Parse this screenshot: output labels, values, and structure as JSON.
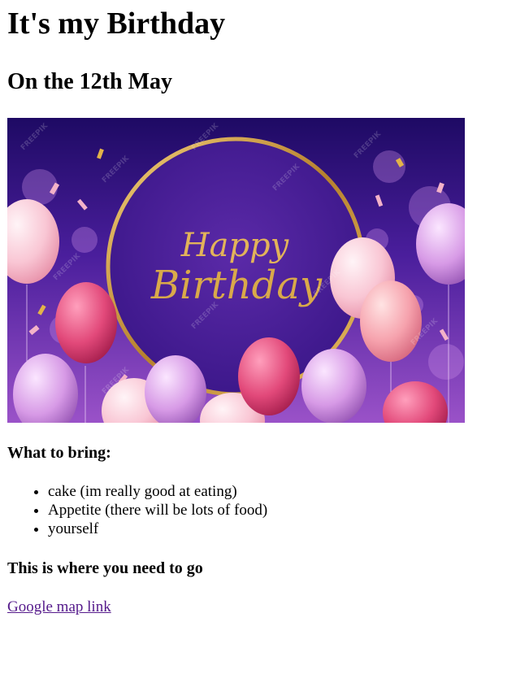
{
  "page": {
    "title": "It's my Birthday",
    "subtitle": "On the 12th May"
  },
  "banner": {
    "text_line1": "Happy",
    "text_line2": "Birthday",
    "watermark": "FREEPIK",
    "colors": {
      "bg_dark": "#2a1070",
      "bg_light": "#8a3ec4",
      "ring": "#c8963a",
      "text_gold": "#d9a94a"
    }
  },
  "bring": {
    "heading": "What to bring:",
    "items": [
      "cake (im really good at eating)",
      "Appetite (there will be lots of food)",
      "yourself"
    ]
  },
  "directions": {
    "heading": "This is where you need to go",
    "link_text": "Google map link"
  }
}
